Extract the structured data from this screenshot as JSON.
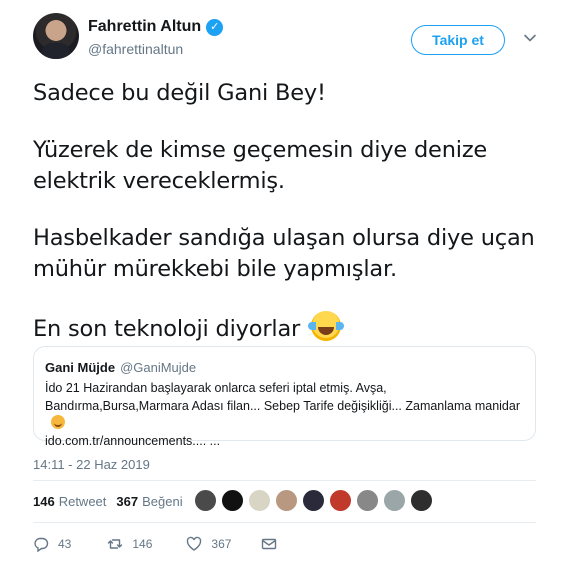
{
  "author": {
    "display_name": "Fahrettin Altun",
    "handle": "@fahrettinaltun",
    "verified_icon": "✓"
  },
  "follow_button": {
    "label": "Takip et"
  },
  "tweet_text": {
    "p1": "Sadece bu değil Gani Bey!",
    "p2": "Yüzerek de kimse geçemesin diye denize elektrik vereceklermiş.",
    "p3": "Hasbelkader sandığa ulaşan olursa diye uçan mühür mürekkebi bile yapmışlar.",
    "p4": "En son teknoloji diyorlar"
  },
  "quoted_tweet": {
    "name": "Gani Müjde",
    "handle": "@GaniMujde",
    "text": "İdo 21 Hazirandan başlayarak onlarca seferi iptal etmiş. Avşa, Bandırma,Bursa,Marmara Adası filan... Sebep Tarife değişikliği... Zamanlama manidar",
    "link": "ido.com.tr/announcements.... ..."
  },
  "timestamp": "14:11 - 22 Haz 2019",
  "stats": {
    "retweets_count": "146",
    "retweets_label": "Retweet",
    "likes_count": "367",
    "likes_label": "Beğeni"
  },
  "likers": [
    "#4a4a4a",
    "#111111",
    "#d9d5c5",
    "#b89880",
    "#2a2a3a",
    "#c0392b",
    "#888888",
    "#9aa6a8",
    "#2e2e2e"
  ],
  "actions": {
    "reply_count": "43",
    "retweet_count": "146",
    "like_count": "367"
  },
  "colors": {
    "accent": "#1da1f2",
    "muted": "#657786"
  }
}
